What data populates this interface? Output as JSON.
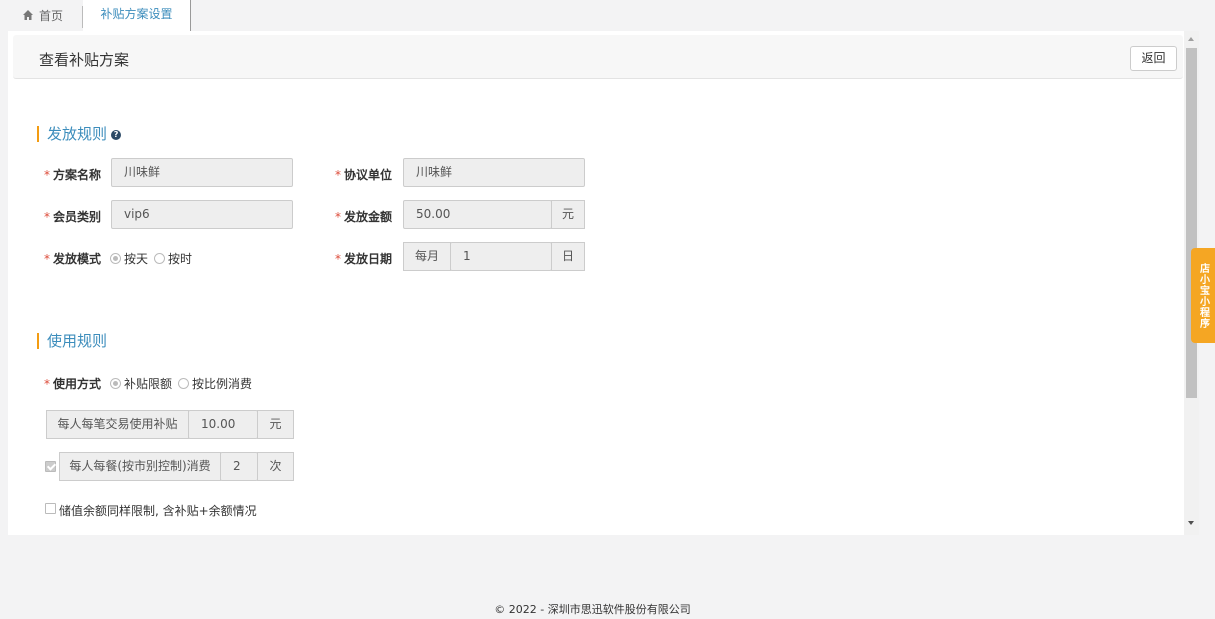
{
  "tabs": {
    "home_label": "首页",
    "active_label": "补贴方案设置"
  },
  "header": {
    "title": "查看补贴方案",
    "back_label": "返回"
  },
  "issue_rules": {
    "section_title": "发放规则",
    "plan_name_label": "方案名称",
    "plan_name_value": "川味鲜",
    "agreement_unit_label": "协议单位",
    "agreement_unit_value": "川味鲜",
    "member_type_label": "会员类别",
    "member_type_value": "vip6",
    "issue_amount_label": "发放金额",
    "issue_amount_value": "50.00",
    "issue_amount_unit": "元",
    "issue_mode_label": "发放模式",
    "issue_mode_options": [
      "按天",
      "按时"
    ],
    "issue_mode_selected": "按天",
    "issue_date_label": "发放日期",
    "issue_date_prefix": "每月",
    "issue_date_value": "1",
    "issue_date_unit": "日"
  },
  "usage_rules": {
    "section_title": "使用规则",
    "usage_mode_label": "使用方式",
    "usage_mode_options": [
      "补贴限额",
      "按比例消费"
    ],
    "usage_mode_selected": "补贴限额",
    "per_txn_label": "每人每笔交易使用补贴",
    "per_txn_value": "10.00",
    "per_txn_unit": "元",
    "per_meal_label": "每人每餐(按市别控制)消费",
    "per_meal_value": "2",
    "per_meal_unit": "次",
    "per_meal_checked": true,
    "balance_limit_label": "储值余额同样限制, 含补贴+余额情况",
    "balance_limit_checked": false
  },
  "side_tab": {
    "label": "店小宝小程序"
  },
  "footer": {
    "copyright": "© 2022 - 深圳市思迅软件股份有限公司"
  },
  "colors": {
    "accent": "#3c8dbc",
    "section_bar": "#f39c12",
    "required": "#dd4b39",
    "side_tab": "#f5a623"
  }
}
